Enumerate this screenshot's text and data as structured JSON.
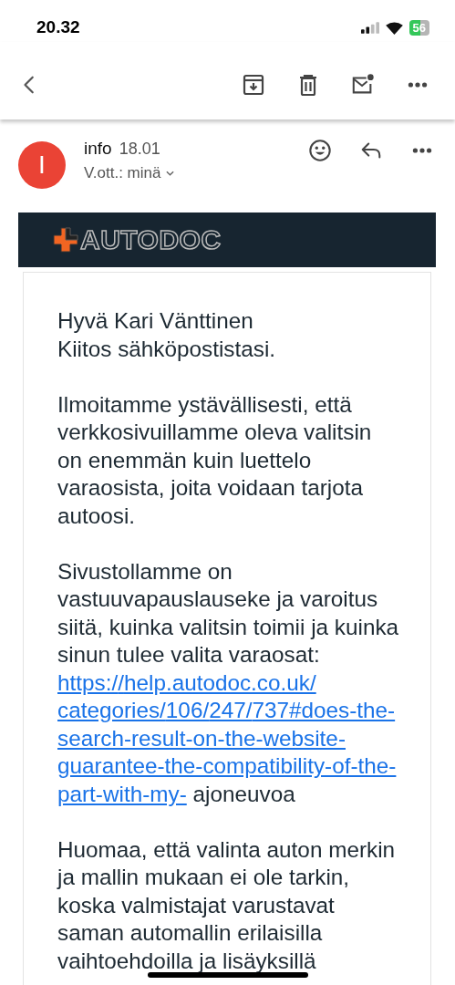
{
  "status_bar": {
    "time": "20.32",
    "battery": "56"
  },
  "toolbar": {
    "actions": [
      {
        "kind": "back"
      },
      {
        "kind": "archive"
      },
      {
        "kind": "delete"
      },
      {
        "kind": "unread"
      },
      {
        "kind": "more"
      }
    ]
  },
  "message": {
    "avatar": "I",
    "sender": "info",
    "time": "18.01",
    "recipient": "V.ott.: minä",
    "actions": [
      {
        "kind": "emoji"
      },
      {
        "kind": "reply"
      },
      {
        "kind": "more"
      }
    ]
  },
  "banner": {
    "logo": "AUTODOC"
  },
  "body": [
    {
      "kind": "text",
      "text": "Hyvä Kari Vänttinen\nKiitos sähköpostistasi."
    },
    {
      "kind": "text",
      "text": "Ilmoitamme ystävällisesti, että verkkosivuillamme oleva valitsin on enemmän kuin luettelo varaosista, joita voidaan tarjota autoosi."
    },
    {
      "kind": "link",
      "text": "Sivustollamme on vastuuvapauslauseke ja varoitus siitä, kuinka valitsin toimii ja kuinka sinun tulee valita varaosat:",
      "link": "https://help.autodoc.co.uk/categories/106/247/737#does-the-search-result-on-the-website-guarantee-the-compatibility-of-the-part-with-my-",
      "after": "ajoneuvoa"
    },
    {
      "kind": "text",
      "text": "Huomaa, että valinta auton merkin ja mallin mukaan ei ole tarkin, koska valmistajat varustavat saman automallin erilaisilla vaihtoehdoilla ja lisäyksillä"
    }
  ]
}
